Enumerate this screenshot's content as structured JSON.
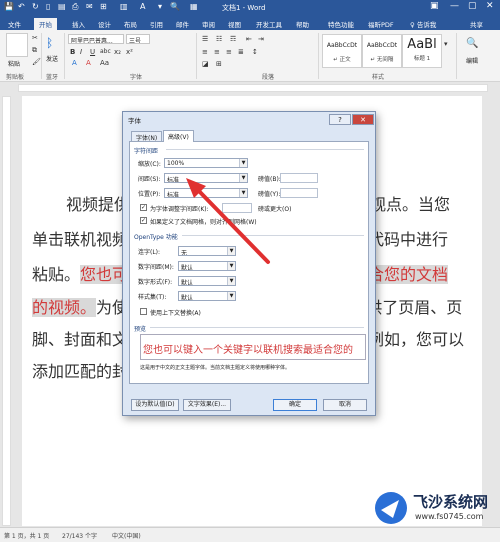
{
  "window": {
    "title": "文档1 - Word",
    "min": "—",
    "restore": "▢",
    "close": "✕",
    "help": "?",
    "ribbon_opts": "▣"
  },
  "tabs": [
    "文件",
    "开始",
    "插入",
    "设计",
    "布局",
    "引用",
    "邮件",
    "审阅",
    "视图",
    "开发工具",
    "帮助",
    "特色功能",
    "福昕PDF",
    "♀ 告诉我",
    "共享"
  ],
  "ribbon": {
    "clipboard": {
      "paste": "粘贴",
      "label": "剪贴板"
    },
    "bluetooth": {
      "send": "发送",
      "label": "蓝牙"
    },
    "font": {
      "name": "阿里巴巴普惠...",
      "size": "三号",
      "label": "字体",
      "tools": [
        "B",
        "I",
        "U",
        "abc",
        "x₂",
        "x²",
        "A",
        "A",
        "Aa"
      ]
    },
    "paragraph": {
      "label": "段落"
    },
    "styles": {
      "label": "样式",
      "items": [
        {
          "preview": "AaBbCcDt",
          "name": "↵ 正文"
        },
        {
          "preview": "AaBbCcDt",
          "name": "↵ 无间隔"
        },
        {
          "preview": "AaBl",
          "name": "标题 1"
        }
      ]
    },
    "edit": {
      "label": "编辑",
      "icon": "🔍"
    }
  },
  "document": {
    "lines": [
      {
        "pre": "",
        "hl": "",
        "post": "视频提供了功能强大的方法帮助您证明您的观点。当您"
      },
      {
        "pre": "单击联机视频时，可以在想要添加的视频的嵌入代码中进行",
        "hl": "",
        "post": ""
      },
      {
        "pre": "粘贴。",
        "hl": "您也可以键入一个关键字以联机搜索最适合您的文档",
        "post": ""
      },
      {
        "pre": "",
        "hl": "的视频。",
        "post": "为使您的文档具有专业外观，Word 提供了页眉、页"
      },
      {
        "pre": "脚、封面和文本框设计，这些设计可互为补充。例如，您可以",
        "hl": "",
        "post": ""
      },
      {
        "pre": "添加匹配的封面、页眉和提要栏。",
        "hl": "",
        "post": ""
      }
    ]
  },
  "dialog": {
    "title": "字体",
    "help": "?",
    "close": "✕",
    "tabs": [
      "字体(N)",
      "高级(V)"
    ],
    "char_spacing_title": "字符间距",
    "scale_label": "缩放(C):",
    "scale_value": "100%",
    "spacing_label": "间距(S):",
    "spacing_value": "标准",
    "position_label": "位置(P):",
    "position_value": "标准",
    "by1_label": "磅值(B):",
    "by2_label": "磅值(Y):",
    "kerning_label": "为字体调整字间距(K):",
    "kerning_suffix": "磅或更大(O)",
    "grid_label": "如果定义了文档网格，则对齐到网格(W)",
    "opentype_title": "OpenType 功能",
    "ligatures_label": "连字(L):",
    "ligatures_value": "无",
    "num_spacing_label": "数字间距(M):",
    "num_spacing_value": "默认",
    "num_form_label": "数字形式(F):",
    "num_form_value": "默认",
    "style_set_label": "样式集(T):",
    "style_set_value": "默认",
    "contextual_label": "使用上下文替换(A)",
    "preview_title": "预览",
    "preview_text": "您也可以键入一个关键字以联机搜索最适合您的",
    "preview_note": "这是用于中文的正文主题字体。当前文档主题定义将使用哪种字体。",
    "btn_default": "设为默认值(D)",
    "btn_effects": "文字效果(E)...",
    "btn_ok": "确定",
    "btn_cancel": "取消"
  },
  "status": {
    "page": "第 1 页，共 1 页",
    "words": "27/143 个字",
    "lang": "中文(中国)"
  },
  "watermark": {
    "brand": "飞沙系统网",
    "url": "www.fs0745.com"
  },
  "colors": {
    "accent": "#2b579a",
    "highlight_text": "#d23a3a",
    "arrow": "#e03030"
  }
}
